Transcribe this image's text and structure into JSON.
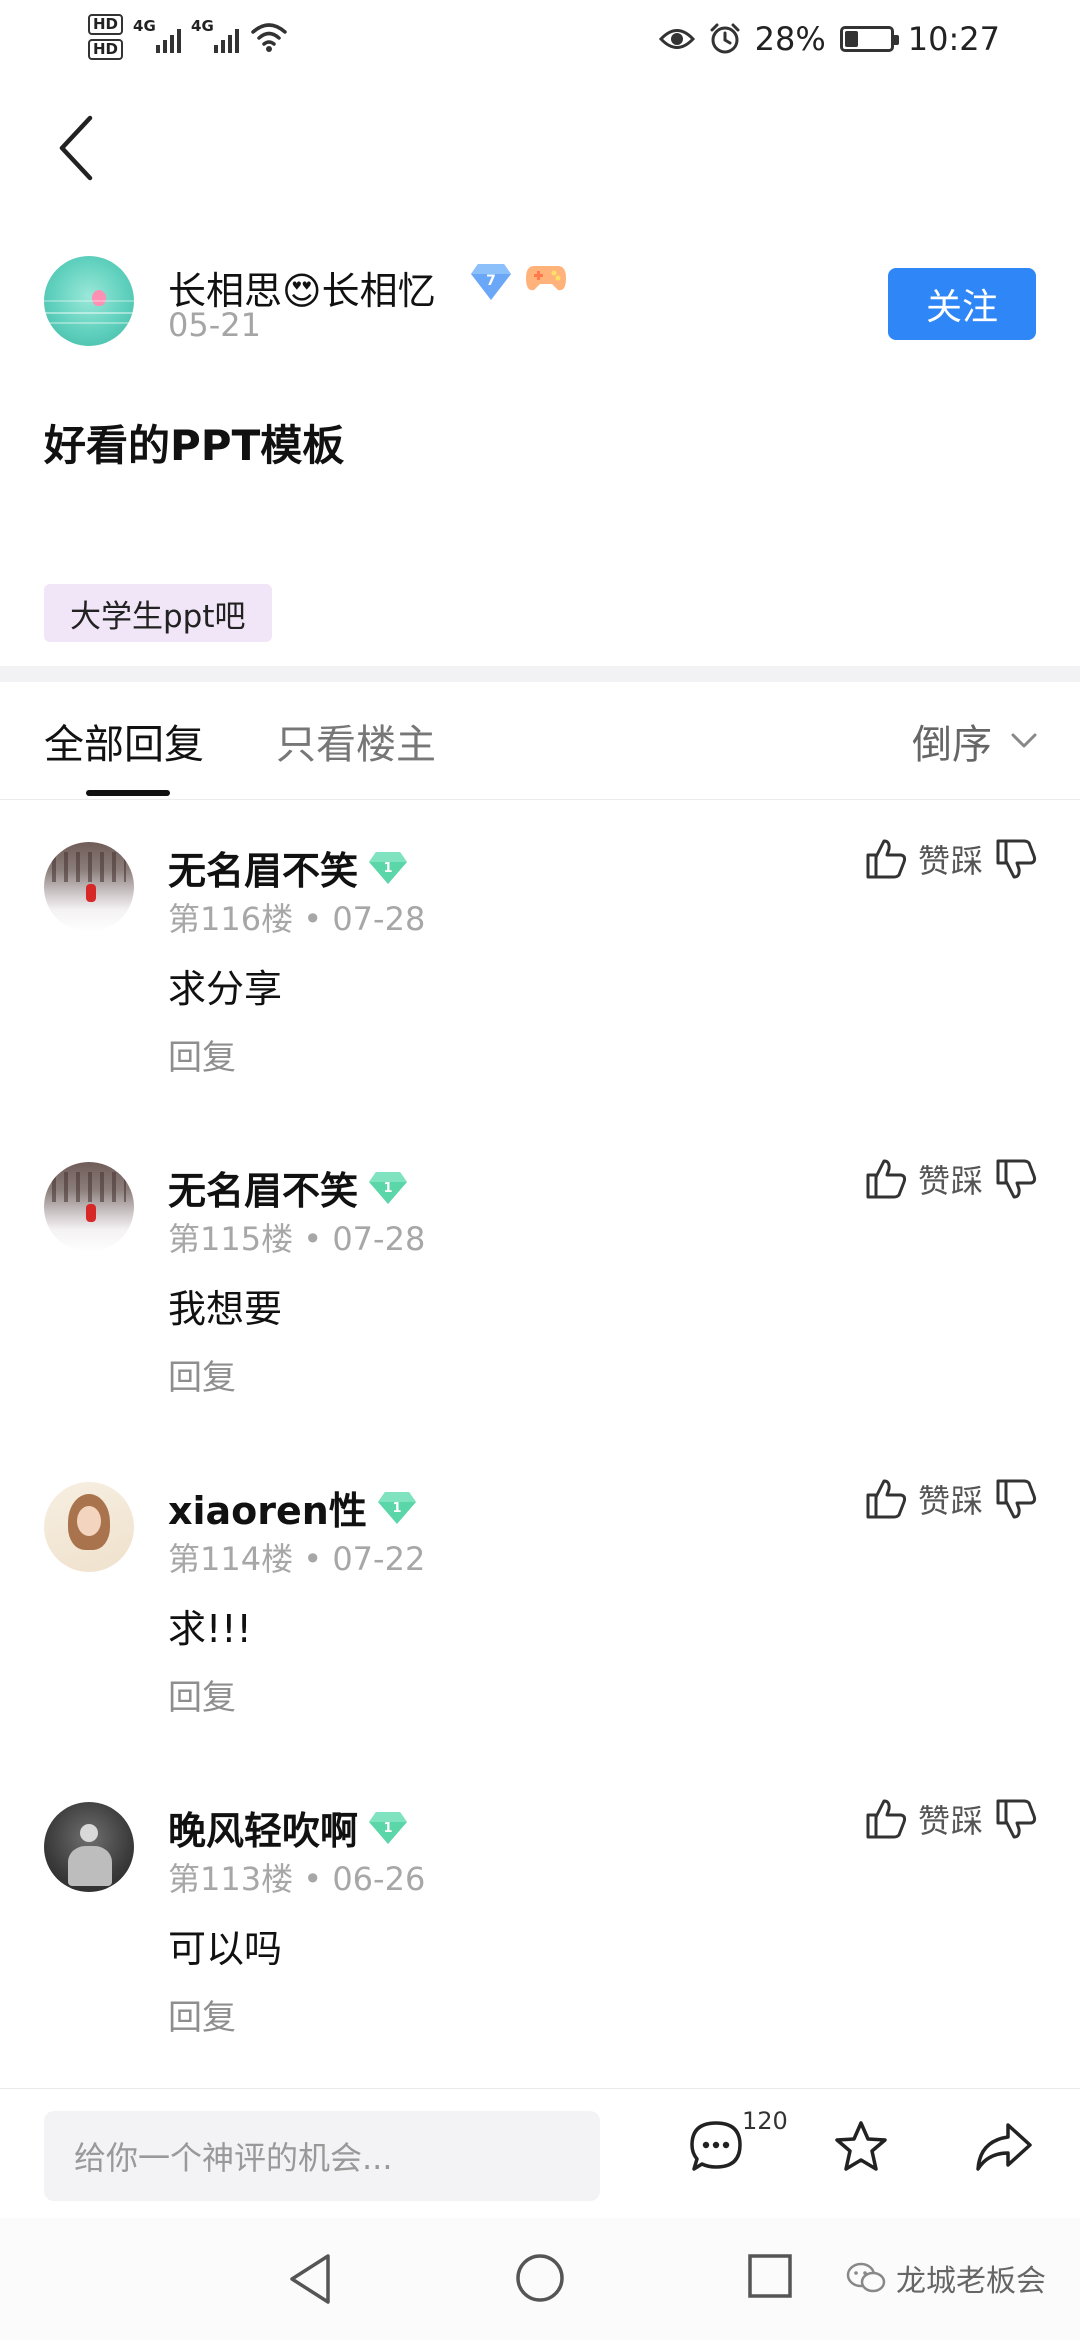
{
  "status_bar": {
    "hd1": "HD",
    "hd2": "HD",
    "net1": "4G",
    "net2": "4G",
    "battery": "28%",
    "time": "10:27"
  },
  "post": {
    "author_name": "长相思😍长相忆",
    "author_level": "7",
    "date": "05-21",
    "follow_label": "关注",
    "title": "好看的PPT模板",
    "forum_tag": "大学生ppt吧"
  },
  "tabs": {
    "all_replies": "全部回复",
    "owner_only": "只看楼主",
    "sort": "倒序"
  },
  "comments": [
    {
      "name": "无名眉不笑",
      "level": "1",
      "floor": "第116楼",
      "date": "07-28",
      "text": "求分享",
      "reply": "回复",
      "vote": "赞踩"
    },
    {
      "name": "无名眉不笑",
      "level": "1",
      "floor": "第115楼",
      "date": "07-28",
      "text": "我想要",
      "reply": "回复",
      "vote": "赞踩"
    },
    {
      "name": "xiaoren性",
      "level": "1",
      "floor": "第114楼",
      "date": "07-22",
      "text": "求!!!",
      "reply": "回复",
      "vote": "赞踩"
    },
    {
      "name": "晚风轻吹啊",
      "level": "1",
      "floor": "第113楼",
      "date": "06-26",
      "text": "可以吗",
      "reply": "回复",
      "vote": "赞踩"
    }
  ],
  "bottom_bar": {
    "input_placeholder": "给你一个神评的机会...",
    "comment_count": "120"
  },
  "watermark": "龙城老板会",
  "colors": {
    "accent_blue": "#2f86f6",
    "level_green": "#5bd6a8",
    "level_blue": "#6aa8f7",
    "tag_bg": "#f1e6f7"
  },
  "icons": [
    "back-arrow-icon",
    "thumb-up-icon",
    "thumb-down-icon",
    "chat-icon",
    "star-icon",
    "share-icon",
    "wechat-icon"
  ]
}
